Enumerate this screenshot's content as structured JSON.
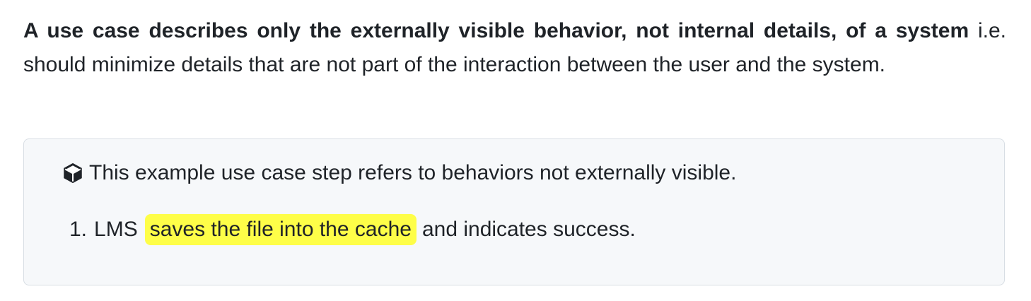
{
  "intro": {
    "bold_text": "A use case describes only the externally visible behavior, not internal details, of a system",
    "normal_text": " i.e. should minimize details that are not part of the interaction between the user and the system."
  },
  "example": {
    "icon": "cube-icon",
    "heading": "This example use case step refers to behaviors not externally visible.",
    "steps": [
      {
        "number": "1.",
        "before": "LMS",
        "highlight": "saves the file into the cache",
        "after": "and indicates success."
      }
    ],
    "colors": {
      "highlight": "#fefe48",
      "box_background": "#f6f8fa",
      "box_border": "#d8dee4"
    }
  }
}
